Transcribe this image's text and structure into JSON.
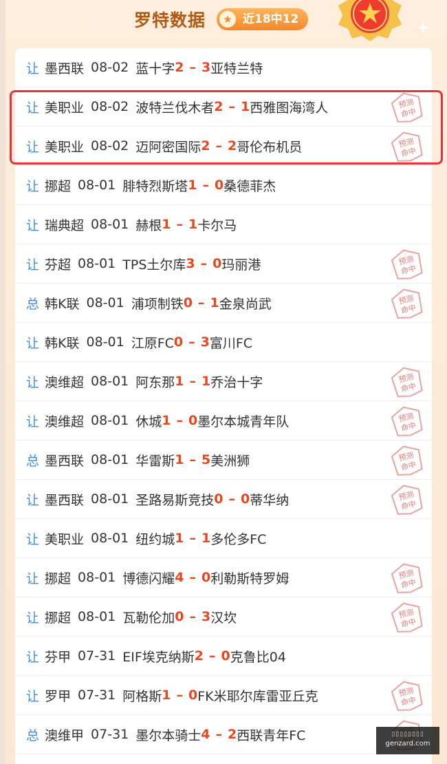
{
  "header": {
    "title": "罗特数据",
    "badge": "近18中12",
    "badge_icon": "star-icon",
    "medal_icon": "medal-icon"
  },
  "colors": {
    "type_label": "#3f8ee6",
    "score": "#e8471f",
    "highlight_border": "#e8323a",
    "title": "#b05a14"
  },
  "matches": [
    {
      "type": "让",
      "league": "墨西联",
      "date": "08-02",
      "home": "蓝十字",
      "home_score": "2",
      "away_score": "3",
      "away": "亚特兰特",
      "hit": false
    },
    {
      "type": "让",
      "league": "美职业",
      "date": "08-02",
      "home": "波特兰伐木者",
      "home_score": "2",
      "away_score": "1",
      "away": "西雅图海湾人",
      "hit": true
    },
    {
      "type": "让",
      "league": "美职业",
      "date": "08-02",
      "home": "迈阿密国际",
      "home_score": "2",
      "away_score": "2",
      "away": "哥伦布机员",
      "hit": true
    },
    {
      "type": "让",
      "league": "挪超",
      "date": "08-01",
      "home": "腓特烈斯塔",
      "home_score": "1",
      "away_score": "0",
      "away": "桑德菲杰",
      "hit": false
    },
    {
      "type": "让",
      "league": "瑞典超",
      "date": "08-01",
      "home": "赫根",
      "home_score": "1",
      "away_score": "1",
      "away": "卡尔马",
      "hit": false
    },
    {
      "type": "让",
      "league": "芬超",
      "date": "08-01",
      "home": "TPS土尔库",
      "home_score": "3",
      "away_score": "0",
      "away": "玛丽港",
      "hit": true
    },
    {
      "type": "总",
      "league": "韩K联",
      "date": "08-01",
      "home": "浦项制铁",
      "home_score": "0",
      "away_score": "1",
      "away": "金泉尚武",
      "hit": true
    },
    {
      "type": "让",
      "league": "韩K联",
      "date": "08-01",
      "home": "江原FC",
      "home_score": "0",
      "away_score": "3",
      "away": "富川FC",
      "hit": false
    },
    {
      "type": "让",
      "league": "澳维超",
      "date": "08-01",
      "home": "阿东那",
      "home_score": "1",
      "away_score": "1",
      "away": "乔治十字",
      "hit": true
    },
    {
      "type": "让",
      "league": "澳维超",
      "date": "08-01",
      "home": "休城",
      "home_score": "1",
      "away_score": "0",
      "away": "墨尔本城青年队",
      "hit": true
    },
    {
      "type": "总",
      "league": "墨西联",
      "date": "08-01",
      "home": "华雷斯",
      "home_score": "1",
      "away_score": "5",
      "away": "美洲狮",
      "hit": true
    },
    {
      "type": "让",
      "league": "墨西联",
      "date": "08-01",
      "home": "圣路易斯竞技",
      "home_score": "0",
      "away_score": "0",
      "away": "蒂华纳",
      "hit": true
    },
    {
      "type": "让",
      "league": "美职业",
      "date": "08-01",
      "home": "纽约城",
      "home_score": "1",
      "away_score": "1",
      "away": "多伦多FC",
      "hit": false
    },
    {
      "type": "让",
      "league": "挪超",
      "date": "08-01",
      "home": "博德闪耀",
      "home_score": "4",
      "away_score": "0",
      "away": "利勒斯特罗姆",
      "hit": true
    },
    {
      "type": "让",
      "league": "挪超",
      "date": "08-01",
      "home": "瓦勒伦加",
      "home_score": "0",
      "away_score": "3",
      "away": "汉坎",
      "hit": true
    },
    {
      "type": "让",
      "league": "芬甲",
      "date": "07-31",
      "home": "EIF埃克纳斯",
      "home_score": "2",
      "away_score": "0",
      "away": "克鲁比04",
      "hit": false
    },
    {
      "type": "让",
      "league": "罗甲",
      "date": "07-31",
      "home": "阿格斯",
      "home_score": "1",
      "away_score": "0",
      "away": "FK米耶尔库雷亚丘克",
      "hit": true
    },
    {
      "type": "总",
      "league": "澳维甲",
      "date": "07-31",
      "home": "墨尔本骑士",
      "home_score": "4",
      "away_score": "2",
      "away": "西联青年FC",
      "hit": true
    }
  ],
  "stamp": {
    "line1": "预测",
    "line2": "命中"
  },
  "watermark": {
    "logo": "▯▯▯▯▯▯▯▯",
    "text": "genzard.com"
  }
}
